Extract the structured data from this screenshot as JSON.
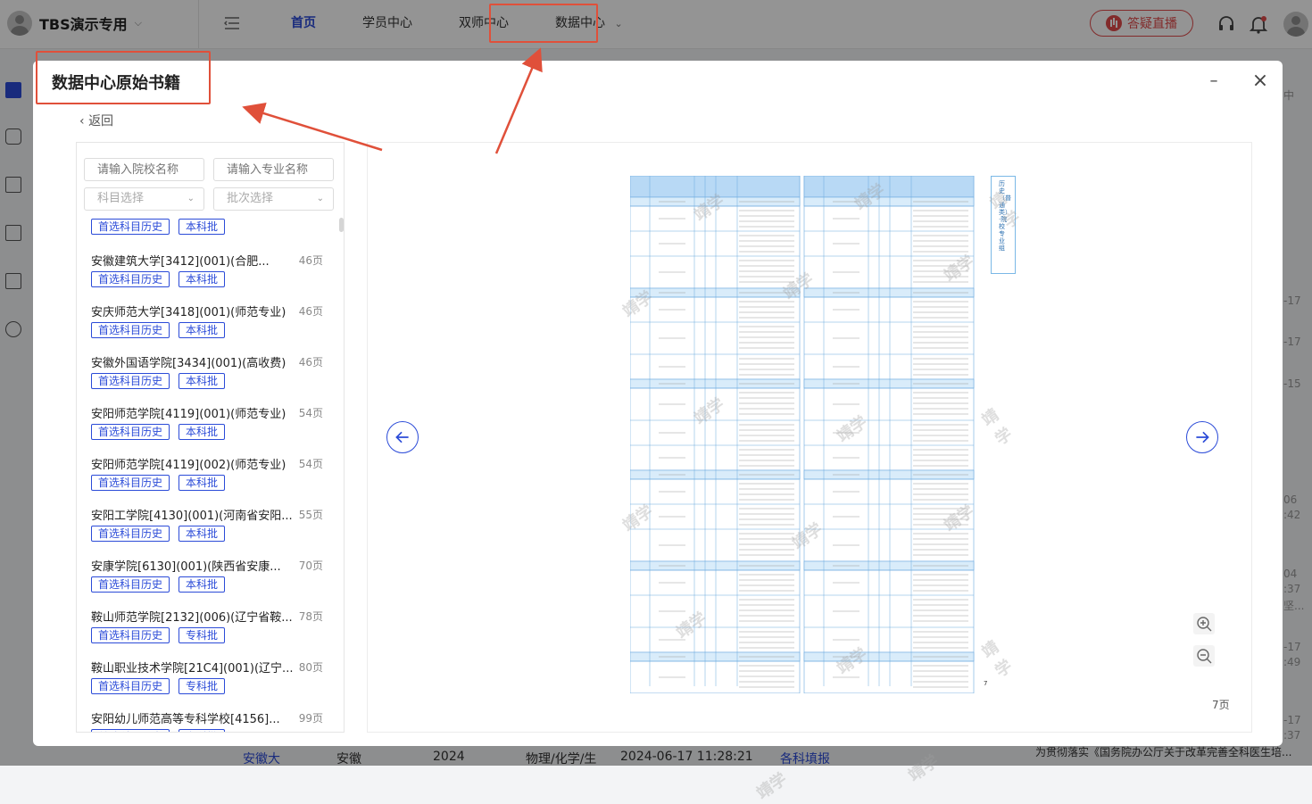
{
  "app": {
    "brand": "TBS演示专用",
    "nav": [
      "首页",
      "学员中心",
      "双师中心",
      "数据中心"
    ],
    "live_button": "答疑直播"
  },
  "background": {
    "snippets": [
      "中",
      "-17",
      "-17",
      "-15",
      "06",
      ":42",
      "04",
      ":37",
      "坚...",
      "-17",
      ":49",
      "-17",
      ":37"
    ],
    "bottom_row": [
      "安徽大",
      "安徽",
      "2024",
      "物理/化学/生",
      "2024-06-17 11:28:21",
      "各科填报"
    ],
    "news": "为贯彻落实《国务院办公厅关于改革完善全科医生培..."
  },
  "modal": {
    "title": "数据中心原始书籍",
    "back": "返回",
    "filters": {
      "school_placeholder": "请输入院校名称",
      "major_placeholder": "请输入专业名称",
      "subject": "科目选择",
      "batch": "批次选择"
    },
    "top_tags": [
      "首选科目历史",
      "本科批"
    ],
    "books": [
      {
        "name": "安徽建筑大学[3412](001)(合肥...",
        "pages": "46页",
        "tags": [
          "首选科目历史",
          "本科批"
        ]
      },
      {
        "name": "安庆师范大学[3418](001)(师范专业)",
        "pages": "46页",
        "tags": [
          "首选科目历史",
          "本科批"
        ]
      },
      {
        "name": "安徽外国语学院[3434](001)(高收费)",
        "pages": "46页",
        "tags": [
          "首选科目历史",
          "本科批"
        ]
      },
      {
        "name": "安阳师范学院[4119](001)(师范专业)",
        "pages": "54页",
        "tags": [
          "首选科目历史",
          "本科批"
        ]
      },
      {
        "name": "安阳师范学院[4119](002)(师范专业)",
        "pages": "54页",
        "tags": [
          "首选科目历史",
          "本科批"
        ]
      },
      {
        "name": "安阳工学院[4130](001)(河南省安阳...",
        "pages": "55页",
        "tags": [
          "首选科目历史",
          "本科批"
        ]
      },
      {
        "name": "安康学院[6130](001)(陕西省安康...",
        "pages": "70页",
        "tags": [
          "首选科目历史",
          "本科批"
        ]
      },
      {
        "name": "鞍山师范学院[2132](006)(辽宁省鞍...",
        "pages": "78页",
        "tags": [
          "首选科目历史",
          "专科批"
        ]
      },
      {
        "name": "鞍山职业技术学院[21C4](001)(辽宁...",
        "pages": "80页",
        "tags": [
          "首选科目历史",
          "专科批"
        ]
      },
      {
        "name": "安阳幼儿师范高等专科学校[4156]...",
        "pages": "99页",
        "tags": [
          "首选科目历史",
          "专科批"
        ]
      }
    ],
    "viewer": {
      "page_count": "7页",
      "page_number": "7",
      "watermark": "靖学",
      "side_label": "历史（普通类）·院校专业组"
    }
  },
  "icons": {
    "menu_toggle": "menu-fold-icon",
    "headset": "headset-icon",
    "bell": "bell-icon",
    "user": "user-avatar-icon",
    "prev": "arrow-left-icon",
    "next": "arrow-right-icon",
    "zoom_in": "zoom-in-icon",
    "zoom_out": "zoom-out-icon",
    "minimize": "minimize-icon",
    "close": "close-icon"
  },
  "colors": {
    "primary": "#2b4bd8",
    "live": "#e04a4a",
    "annotation": "#e0503a",
    "table_header": "#b8d9f5"
  }
}
